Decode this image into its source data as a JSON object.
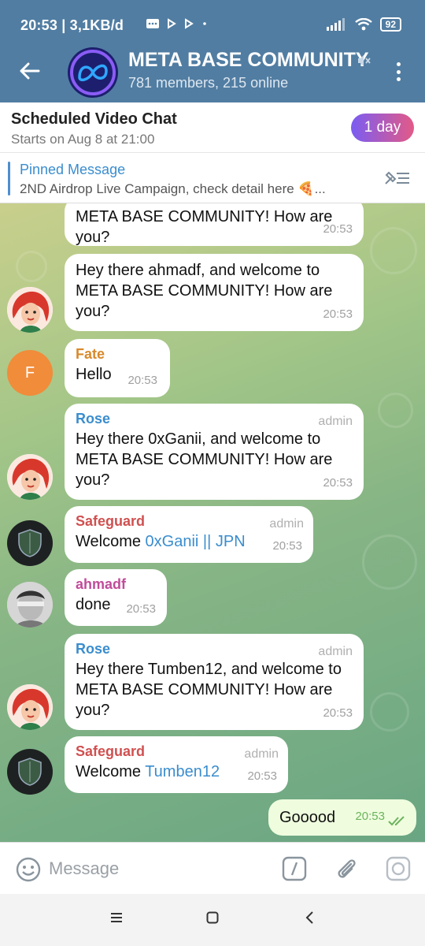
{
  "status_bar": {
    "time_network": "20:53 | 3,1KB/d",
    "battery": "92"
  },
  "header": {
    "title": "META BASE COMMUNITY",
    "subtitle": "781 members, 215 online"
  },
  "video_chat": {
    "title": "Scheduled Video Chat",
    "subtitle": "Starts on Aug 8 at 21:00",
    "countdown": "1 day"
  },
  "pinned": {
    "label": "Pinned Message",
    "text": "2ND Airdrop Live Campaign, check detail here 🍕..."
  },
  "messages": [
    {
      "text": "META BASE COMMUNITY! How are you?",
      "time": "20:53"
    },
    {
      "text": "Hey there ahmadf, and welcome to META BASE COMMUNITY! How are you?",
      "time": "20:53"
    },
    {
      "sender": "Fate",
      "text": "Hello",
      "time": "20:53",
      "avatar_letter": "F"
    },
    {
      "sender": "Rose",
      "badge": "admin",
      "text": "Hey there 0xGanii, and welcome to META BASE COMMUNITY! How are you?",
      "time": "20:53"
    },
    {
      "sender": "Safeguard",
      "badge": "admin",
      "text_prefix": "Welcome ",
      "link": "0xGanii || JPN",
      "time": "20:53"
    },
    {
      "sender": "ahmadf",
      "text": "done",
      "time": "20:53"
    },
    {
      "sender": "Rose",
      "badge": "admin",
      "text": "Hey there Tumben12, and welcome to META BASE COMMUNITY! How are you?",
      "time": "20:53"
    },
    {
      "sender": "Safeguard",
      "badge": "admin",
      "text_prefix": "Welcome ",
      "link": "Tumben12",
      "time": "20:53"
    },
    {
      "text": "Gooood",
      "time": "20:53",
      "outgoing": true
    }
  ],
  "input": {
    "placeholder": "Message"
  },
  "colors": {
    "header": "#517da2",
    "sender_rose": "#3a8dce",
    "sender_fate": "#d8892b",
    "sender_safeguard": "#d05050",
    "sender_ahmadf": "#c04c9a",
    "outgoing_bubble": "#effdde"
  },
  "icons": [
    "back-arrow-icon",
    "mute-icon",
    "more-vert-icon",
    "pin-off-icon",
    "emoji-icon",
    "command-icon",
    "attach-icon",
    "camera-icon",
    "nav-menu-icon",
    "nav-home-icon",
    "nav-back-icon"
  ]
}
